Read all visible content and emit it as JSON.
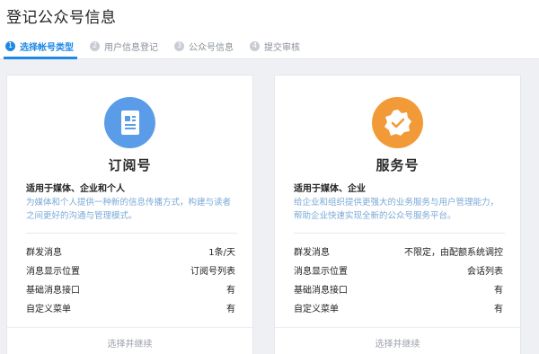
{
  "page": {
    "title": "登记公众号信息"
  },
  "steps": [
    {
      "num": "1",
      "label": "选择帐号类型",
      "active": true
    },
    {
      "num": "2",
      "label": "用户信息登记",
      "active": false
    },
    {
      "num": "3",
      "label": "公众号信息",
      "active": false
    },
    {
      "num": "4",
      "label": "提交审核",
      "active": false
    }
  ],
  "cards": [
    {
      "icon": "document-icon",
      "icon_color": "#5a9ce8",
      "title": "订阅号",
      "audience": "适用于媒体、企业和个人",
      "description": "为媒体和个人提供一种新的信息传播方式，构建与读者之间更好的沟通与管理模式。",
      "rows": [
        {
          "label": "群发消息",
          "value": "1条/天"
        },
        {
          "label": "消息显示位置",
          "value": "订阅号列表"
        },
        {
          "label": "基础消息接口",
          "value": "有"
        },
        {
          "label": "自定义菜单",
          "value": "有"
        }
      ],
      "action": "选择并继续"
    },
    {
      "icon": "verified-badge-icon",
      "icon_color": "#f29a38",
      "title": "服务号",
      "audience": "适用于媒体、企业",
      "description": "给企业和组织提供更强大的业务服务与用户管理能力，帮助企业快速实现全新的公众号服务平台。",
      "rows": [
        {
          "label": "群发消息",
          "value": "不限定，由配额系统调控"
        },
        {
          "label": "消息显示位置",
          "value": "会话列表"
        },
        {
          "label": "基础消息接口",
          "value": "有"
        },
        {
          "label": "自定义菜单",
          "value": "有"
        }
      ],
      "action": "选择并继续"
    }
  ]
}
